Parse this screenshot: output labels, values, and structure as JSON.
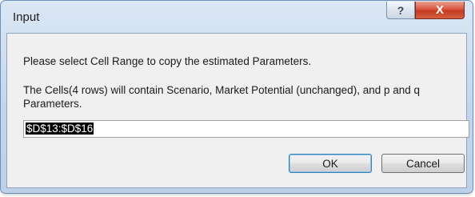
{
  "window": {
    "title": "Input",
    "help_glyph": "?",
    "close_glyph": "X"
  },
  "dialog": {
    "prompt": "Please select Cell Range to copy the estimated Parameters.",
    "description": "The Cells(4 rows) will contain Scenario, Market Potential (unchanged), and p and q Parameters.",
    "input_value": "$D$13:$D$16",
    "ok_label": "OK",
    "cancel_label": "Cancel"
  }
}
